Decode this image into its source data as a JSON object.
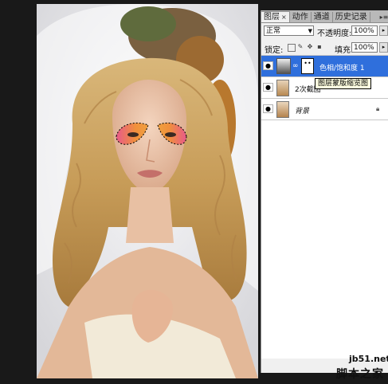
{
  "panel": {
    "tabs": [
      {
        "label": "图层",
        "close": "×",
        "active": true
      },
      {
        "label": "动作",
        "active": false
      },
      {
        "label": "通道",
        "active": false
      },
      {
        "label": "历史记录",
        "active": false
      }
    ],
    "menu_icon": "panel-menu-icon"
  },
  "blend": {
    "mode": "正常",
    "opacity_label": "不透明度:",
    "opacity": "100%"
  },
  "lock": {
    "label": "锁定:",
    "fill_label": "填充:",
    "fill": "100%",
    "icons": [
      "lock-transparent-icon",
      "lock-pixels-icon",
      "lock-position-icon",
      "lock-all-icon"
    ]
  },
  "layers": [
    {
      "name": "色相/饱和度 1",
      "selected": true,
      "type": "adjustment"
    },
    {
      "name": "2次截图",
      "selected": false,
      "type": "image"
    },
    {
      "name": "背景",
      "selected": false,
      "type": "background",
      "locked": true
    }
  ],
  "tooltip": "图层蒙版缩览图",
  "watermark": {
    "site": "jb51.net",
    "name": "脚本之家"
  },
  "colors": {
    "selected_layer": "#2f6fdc",
    "panel_bg": "#f0f0f0",
    "canvas_bg": "#191919"
  }
}
